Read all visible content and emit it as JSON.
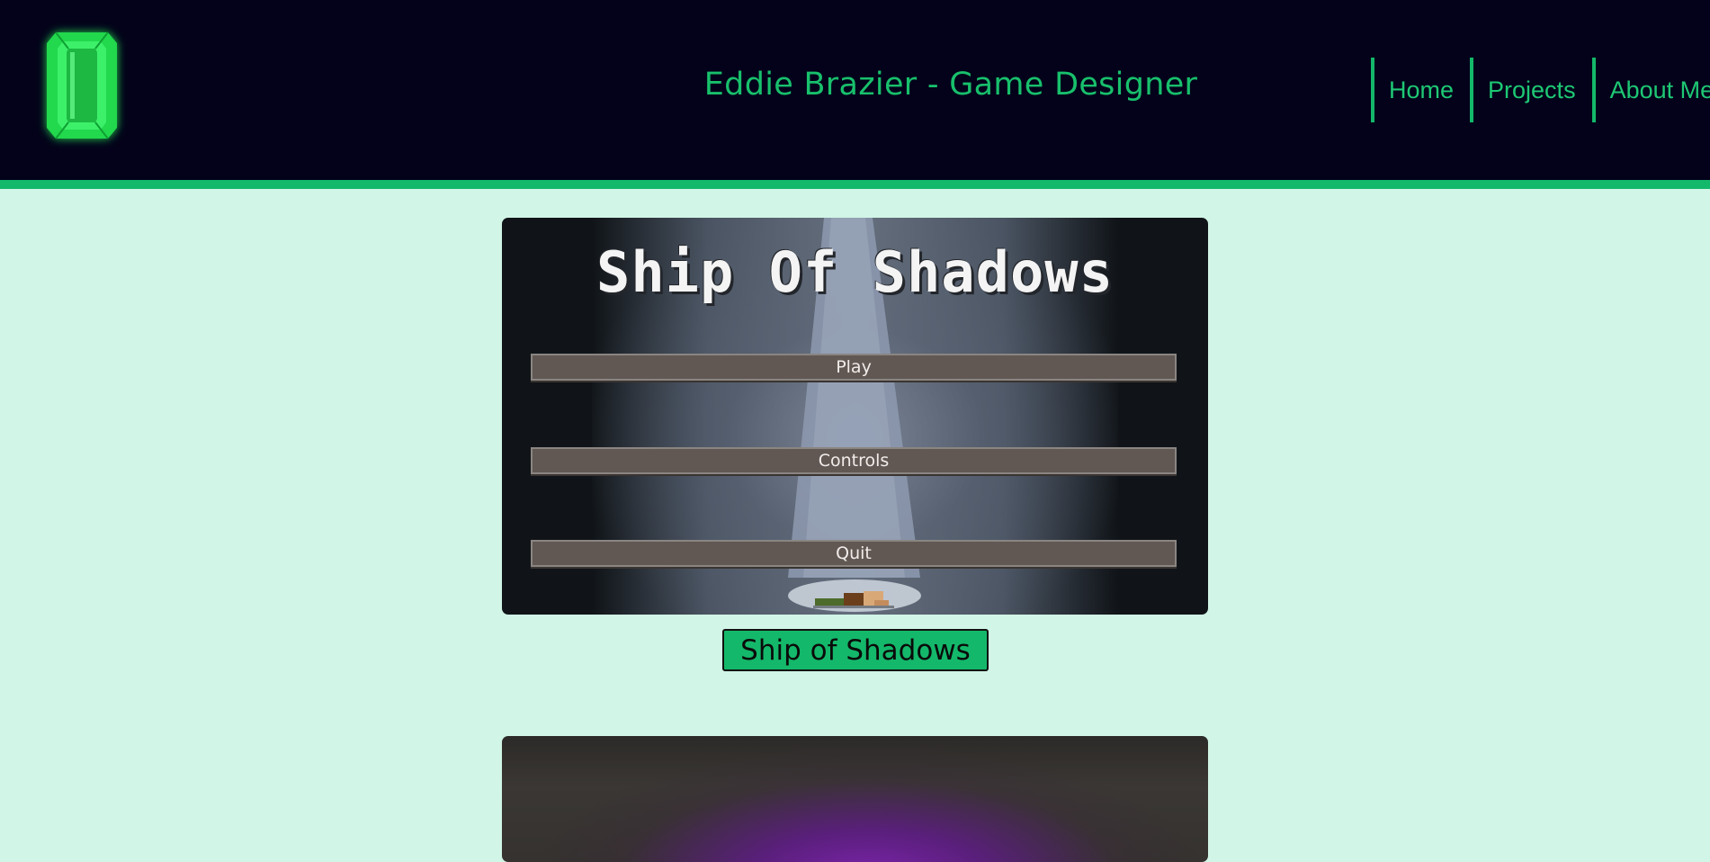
{
  "header": {
    "logo_icon": "green-emerald-gem-icon",
    "title": "Eddie Brazier - Game Designer",
    "nav": [
      "Home",
      "Projects",
      "About Me"
    ]
  },
  "colors": {
    "header_background": "#03021a",
    "accent_green": "#14b86a",
    "page_background": "#d1f5e6",
    "menu_button": "#615853"
  },
  "projects": [
    {
      "game_title": "Ship Of Shadows",
      "menu_buttons": [
        "Play",
        "Controls",
        "Quit"
      ],
      "label": "Ship of Shadows"
    }
  ]
}
